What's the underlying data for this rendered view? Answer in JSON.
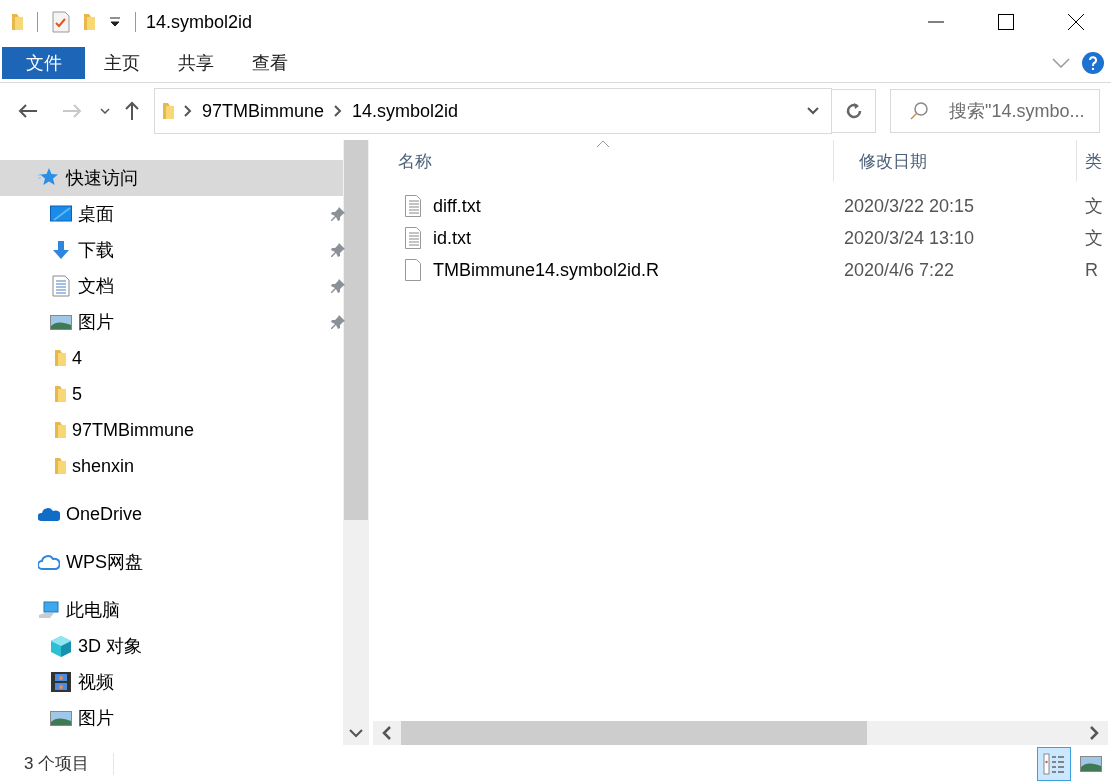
{
  "window": {
    "title": "14.symbol2id"
  },
  "ribbon": {
    "tabs": [
      {
        "label": "文件",
        "selected": true
      },
      {
        "label": "主页",
        "selected": false
      },
      {
        "label": "共享",
        "selected": false
      },
      {
        "label": "查看",
        "selected": false
      }
    ]
  },
  "address_bar": {
    "path": [
      "97TMBimmune",
      "14.symbol2id"
    ]
  },
  "search": {
    "placeholder": "搜索\"14.symbo..."
  },
  "sidebar": {
    "items": [
      {
        "label": "快速访问",
        "kind": "star",
        "selected": true,
        "children": [
          {
            "label": "桌面",
            "kind": "desktop",
            "pinned": true,
            "selected": false
          },
          {
            "label": "下载",
            "kind": "download",
            "pinned": true,
            "selected": false
          },
          {
            "label": "文档",
            "kind": "document",
            "pinned": true,
            "selected": false
          },
          {
            "label": "图片",
            "kind": "picture",
            "pinned": true,
            "selected": false
          },
          {
            "label": "4",
            "kind": "folder",
            "pinned": false,
            "selected": false
          },
          {
            "label": "5",
            "kind": "folder",
            "pinned": false,
            "selected": false
          },
          {
            "label": "97TMBimmune",
            "kind": "folder",
            "pinned": false,
            "selected": false
          },
          {
            "label": "shenxin",
            "kind": "folder",
            "pinned": false,
            "selected": false
          }
        ]
      },
      {
        "label": "OneDrive",
        "kind": "onedrive",
        "selected": false
      },
      {
        "label": "WPS网盘",
        "kind": "cloud",
        "selected": false
      },
      {
        "label": "此电脑",
        "kind": "pc",
        "selected": false,
        "children": [
          {
            "label": "3D 对象",
            "kind": "cube",
            "pinned": false,
            "selected": false
          },
          {
            "label": "视频",
            "kind": "video",
            "pinned": false,
            "selected": false
          },
          {
            "label": "图片",
            "kind": "picture",
            "pinned": false,
            "selected": false
          }
        ]
      }
    ]
  },
  "table": {
    "columns": [
      {
        "label": "名称",
        "sorted": true
      },
      {
        "label": "修改日期",
        "sorted": false
      },
      {
        "label": "类",
        "sorted": false
      }
    ],
    "rows": [
      {
        "kind": "text",
        "cells": [
          "diff.txt",
          "2020/3/22 20:15",
          "文"
        ]
      },
      {
        "kind": "text",
        "cells": [
          "id.txt",
          "2020/3/24 13:10",
          "文"
        ]
      },
      {
        "kind": "blank",
        "cells": [
          "TMBimmune14.symbol2id.R",
          "2020/4/6 7:22",
          "R"
        ]
      }
    ]
  },
  "status_bar": {
    "count": "3 个项目",
    "views": [
      {
        "kind": "details",
        "selected": true
      },
      {
        "kind": "large",
        "selected": false
      }
    ]
  }
}
